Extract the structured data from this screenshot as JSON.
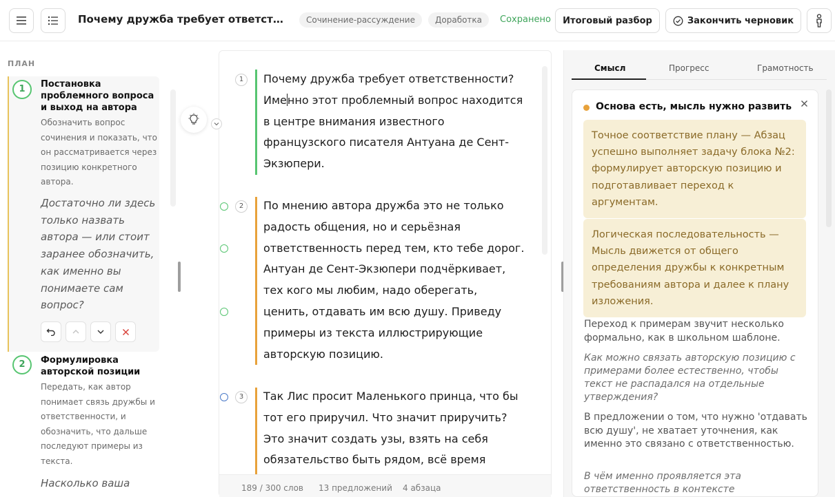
{
  "header": {
    "title": "Почему дружба требует ответственн...",
    "genre_chip": "Сочинение-рассуждение",
    "status_chip": "Доработка",
    "saved_text": "Сохранено",
    "final_review_label": "Итоговый разбор",
    "finish_draft_label": "Закончить черновик",
    "accent_green": "#3fa55b"
  },
  "plan": {
    "heading": "ПЛАН",
    "steps": [
      {
        "number": "1",
        "title": "Постановка проблемного вопроса и выход на автора",
        "description": "Обозначить вопрос сочинения и показать, что он рассматривается через позицию конкретного автора.",
        "question": "Достаточно ли здесь только назвать автора — или стоит заранее обозначить, как именно вы понимаете сам вопрос?"
      },
      {
        "number": "2",
        "title": "Формулировка авторской позиции",
        "description": "Передать, как автор понимает связь дружбы и ответственности, и обозначить, что дальше последуют примеры из текста.",
        "question": "Насколько ваша"
      }
    ]
  },
  "editor": {
    "paragraphs": [
      {
        "number": "1",
        "text_before_caret": "Почему дружба требует ответственности? Име",
        "text_after_caret": "нно этот проблемный вопрос находится в центре внимания известного французского писателя Антуана де Сент-Экзюпери.",
        "bar_color": "#57c571"
      },
      {
        "number": "2",
        "text": "По мнению автора дружба это не только радость общения, но и серьёзная ответственность перед тем, кто тебе дорог. Антуан де Сент-Экзюпери подчёркивает, тех кого мы любим, надо оберегать, ценить, отдавать им всю душу. Приведу примеры из текста иллюстрирующие авторскую позицию.",
        "bar_color": "#e8a23b"
      },
      {
        "number": "3",
        "text": "Так Лис просит Маленького принца, что бы тот его приручил. Что значит приручить? Это значит создать узы, взять на себя обязательство быть рядом, всё время",
        "bar_color": "#e8a23b"
      }
    ],
    "stats": {
      "words": "189 / 300 слов",
      "sentences": "13 предложений",
      "paragraphs": "4 абзаца"
    }
  },
  "feedback": {
    "tabs": [
      "Смысл",
      "Прогресс",
      "Грамотность"
    ],
    "active_tab": "Смысл",
    "title": "Основа есть, мысль нужно развить",
    "status_color": "#e8a23b",
    "callouts": [
      "Точное соответствие плану — Абзац успешно выполняет задачу блока №2: формулирует авторскую позицию и подготавливает переход к аргументам.",
      "Логическая последовательность — Мысль движется от общего определения дружбы к конкретным требованиям автора и далее к плану изложения."
    ],
    "note1": "Переход к примерам звучит несколько формально, как в школьном шаблоне.",
    "question1": "Как можно связать авторскую позицию с примерами более естественно, чтобы текст не распадался на отдельные утверждения?",
    "note2": "В предложении о том, что нужно 'отдавать всю душу', не хватает уточнения, как именно это связано с ответственностью.",
    "question2": "В чём именно проявляется эта ответственность в контексте"
  }
}
